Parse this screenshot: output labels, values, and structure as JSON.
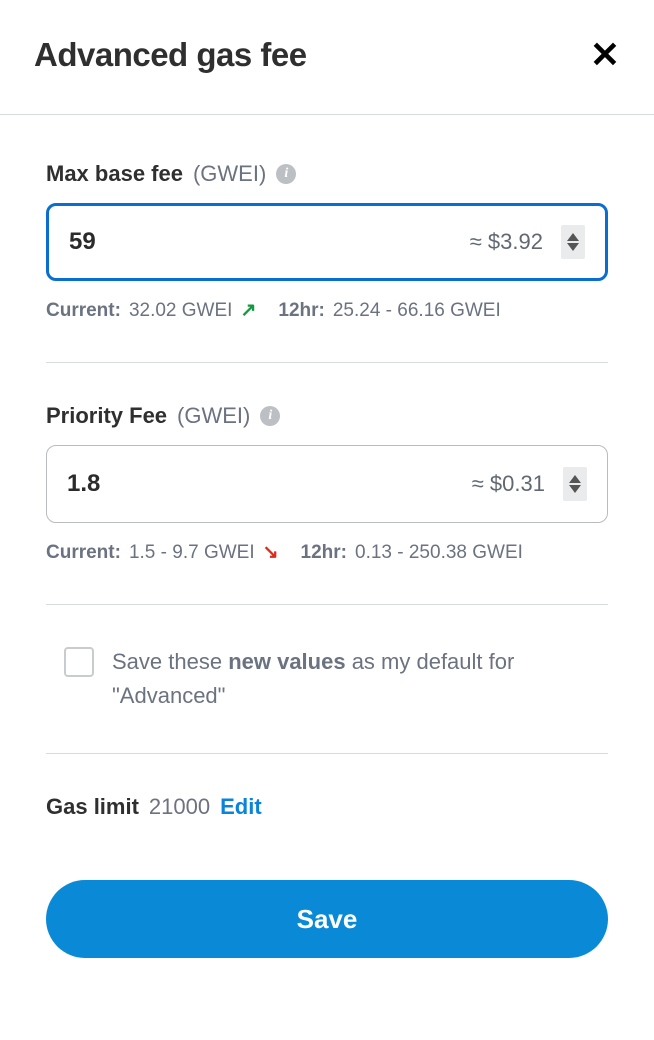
{
  "header": {
    "title": "Advanced gas fee"
  },
  "maxBaseFee": {
    "label": "Max base fee",
    "unit": "(GWEI)",
    "value": "59",
    "approx": "≈ $3.92",
    "currentLabel": "Current:",
    "currentValue": "32.02 GWEI",
    "trendIcon": "↗",
    "twelveHrLabel": "12hr:",
    "twelveHrValue": "25.24 - 66.16 GWEI"
  },
  "priorityFee": {
    "label": "Priority Fee",
    "unit": "(GWEI)",
    "value": "1.8",
    "approx": "≈ $0.31",
    "currentLabel": "Current:",
    "currentValue": "1.5 - 9.7 GWEI",
    "trendIcon": "↘",
    "twelveHrLabel": "12hr:",
    "twelveHrValue": "0.13 - 250.38 GWEI"
  },
  "saveDefault": {
    "prefix": "Save these ",
    "bold": "new values",
    "suffix": " as my default for \"Advanced\""
  },
  "gasLimit": {
    "label": "Gas limit",
    "value": "21000",
    "edit": "Edit"
  },
  "actions": {
    "save": "Save"
  }
}
